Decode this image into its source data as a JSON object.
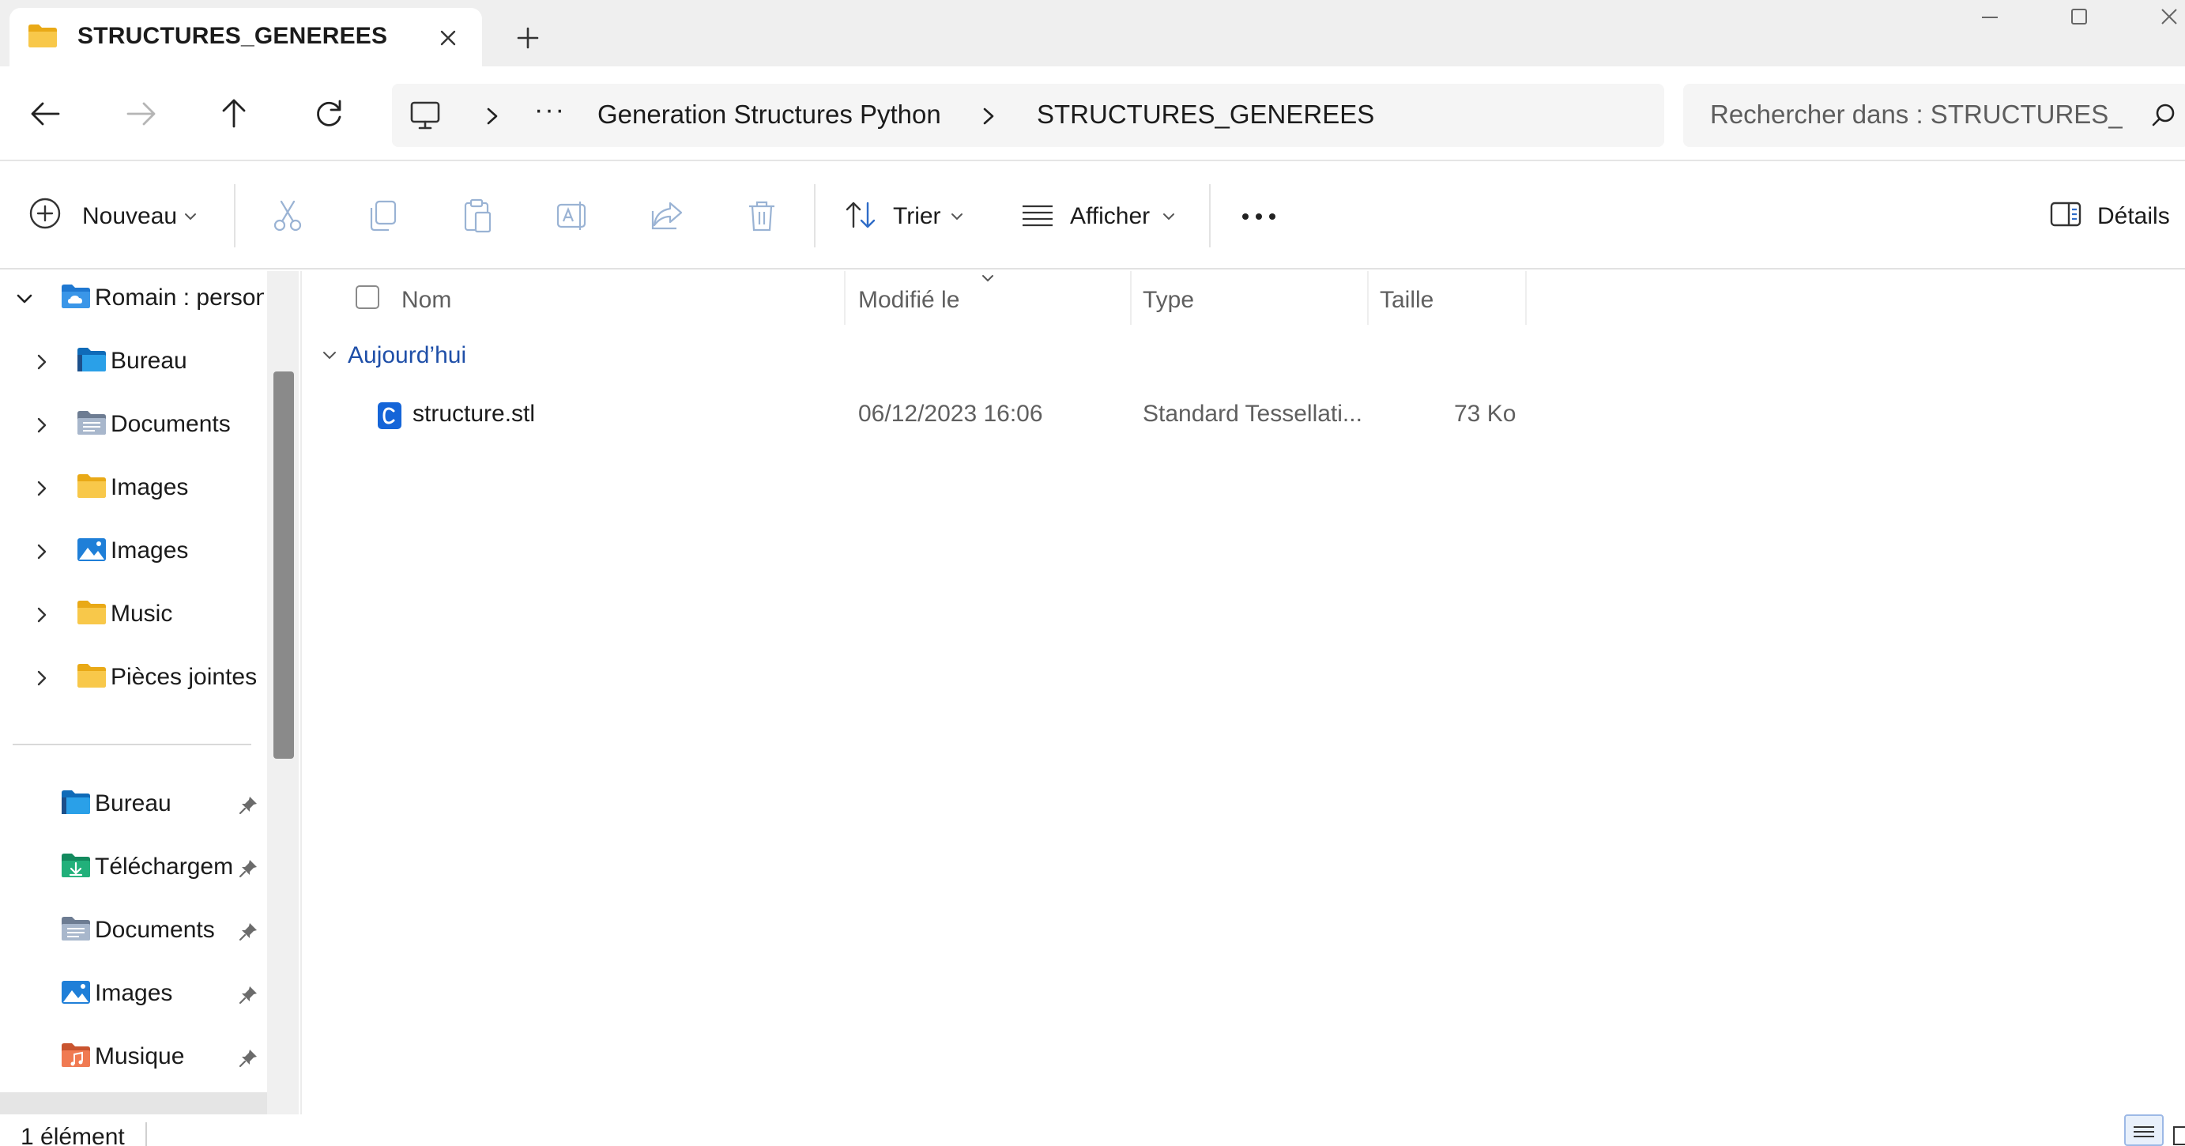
{
  "window": {
    "tab_title": "STRUCTURES_GENEREES",
    "icons": {
      "tab_folder": "folder-icon",
      "tab_close": "close-icon",
      "new_tab": "plus-icon",
      "minimize": "minimize-icon",
      "maximize": "maximize-icon",
      "close": "close-icon"
    }
  },
  "navigation": {
    "back": "arrow-left-icon",
    "forward": "arrow-right-icon",
    "up": "arrow-up-icon",
    "refresh": "refresh-icon",
    "breadcrumb": {
      "root_icon": "computer-icon",
      "more": "···",
      "items": [
        "Generation Structures Python",
        "STRUCTURES_GENEREES"
      ]
    },
    "search": {
      "placeholder": "Rechercher dans : STRUCTURES_GENEREES"
    }
  },
  "commandbar": {
    "new_label": "Nouveau",
    "sort_label": "Trier",
    "view_label": "Afficher",
    "details_label": "Détails",
    "more": "more-icon",
    "actions": [
      "cut-icon",
      "copy-icon",
      "paste-icon",
      "rename-icon",
      "share-icon",
      "delete-icon"
    ]
  },
  "sidebar": {
    "tree": [
      {
        "label": "Romain : personnel",
        "icon": "onedrive-folder-icon",
        "expanded": true
      },
      {
        "label": "Bureau",
        "icon": "desktop-folder-icon"
      },
      {
        "label": "Documents",
        "icon": "documents-folder-icon"
      },
      {
        "label": "Images",
        "icon": "folder-icon"
      },
      {
        "label": "Images",
        "icon": "pictures-folder-icon"
      },
      {
        "label": "Music",
        "icon": "folder-icon"
      },
      {
        "label": "Pièces jointes",
        "icon": "folder-icon"
      }
    ],
    "quick_access": [
      {
        "label": "Bureau",
        "icon": "desktop-folder-icon",
        "pinned": true
      },
      {
        "label": "Téléchargements",
        "icon": "downloads-folder-icon",
        "pinned": true
      },
      {
        "label": "Documents",
        "icon": "documents-folder-icon",
        "pinned": true
      },
      {
        "label": "Images",
        "icon": "pictures-folder-icon",
        "pinned": true
      },
      {
        "label": "Musique",
        "icon": "music-folder-icon",
        "pinned": true
      }
    ]
  },
  "file_list": {
    "columns": [
      "Nom",
      "Modifié le",
      "Type",
      "Taille"
    ],
    "group": "Aujourd’hui",
    "rows": [
      {
        "name": "structure.stl",
        "modified": "06/12/2023 16:06",
        "type": "Standard Tessellati...",
        "size": "73 Ko",
        "icon": "stl-file-icon"
      }
    ]
  },
  "status": {
    "count": "1 élément"
  },
  "colors": {
    "accent": "#1f4fa8",
    "folder_yellow": "#f8c84a",
    "folder_blue": "#2e8ad8"
  }
}
